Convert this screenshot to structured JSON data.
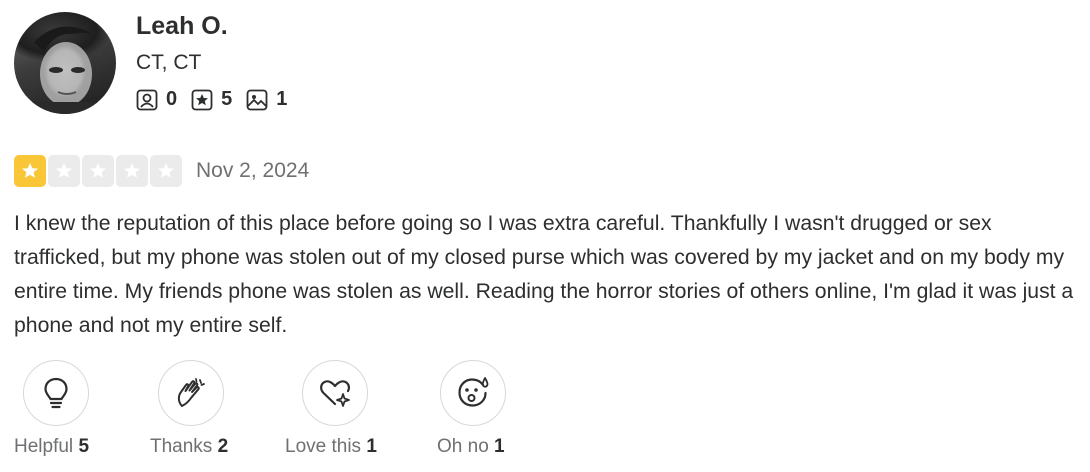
{
  "user": {
    "name": "Leah O.",
    "location": "CT, CT",
    "stats": [
      {
        "icon": "friends-icon",
        "value": "0"
      },
      {
        "icon": "reviews-icon",
        "value": "5"
      },
      {
        "icon": "photos-icon",
        "value": "1"
      }
    ]
  },
  "review": {
    "rating": 1,
    "max_rating": 5,
    "date": "Nov 2, 2024",
    "text": "I knew the reputation of this place before going so I was extra careful. Thankfully I wasn't drugged or sex trafficked, but my phone was stolen out of my closed purse which was covered by my jacket and on my body my entire time. My friends phone was stolen as well. Reading the horror stories of others online, I'm glad it was just a phone and not my entire self."
  },
  "reactions": [
    {
      "label": "Helpful",
      "count": "5",
      "icon": "lightbulb-icon"
    },
    {
      "label": "Thanks",
      "count": "2",
      "icon": "clapping-hands-icon"
    },
    {
      "label": "Love this",
      "count": "1",
      "icon": "heart-sparkle-icon"
    },
    {
      "label": "Oh no",
      "count": "1",
      "icon": "surprised-face-icon"
    }
  ],
  "colors": {
    "star_on": "#f9c638",
    "star_off": "#ebebeb",
    "text": "#2d2e2f",
    "muted": "#6e7072"
  }
}
